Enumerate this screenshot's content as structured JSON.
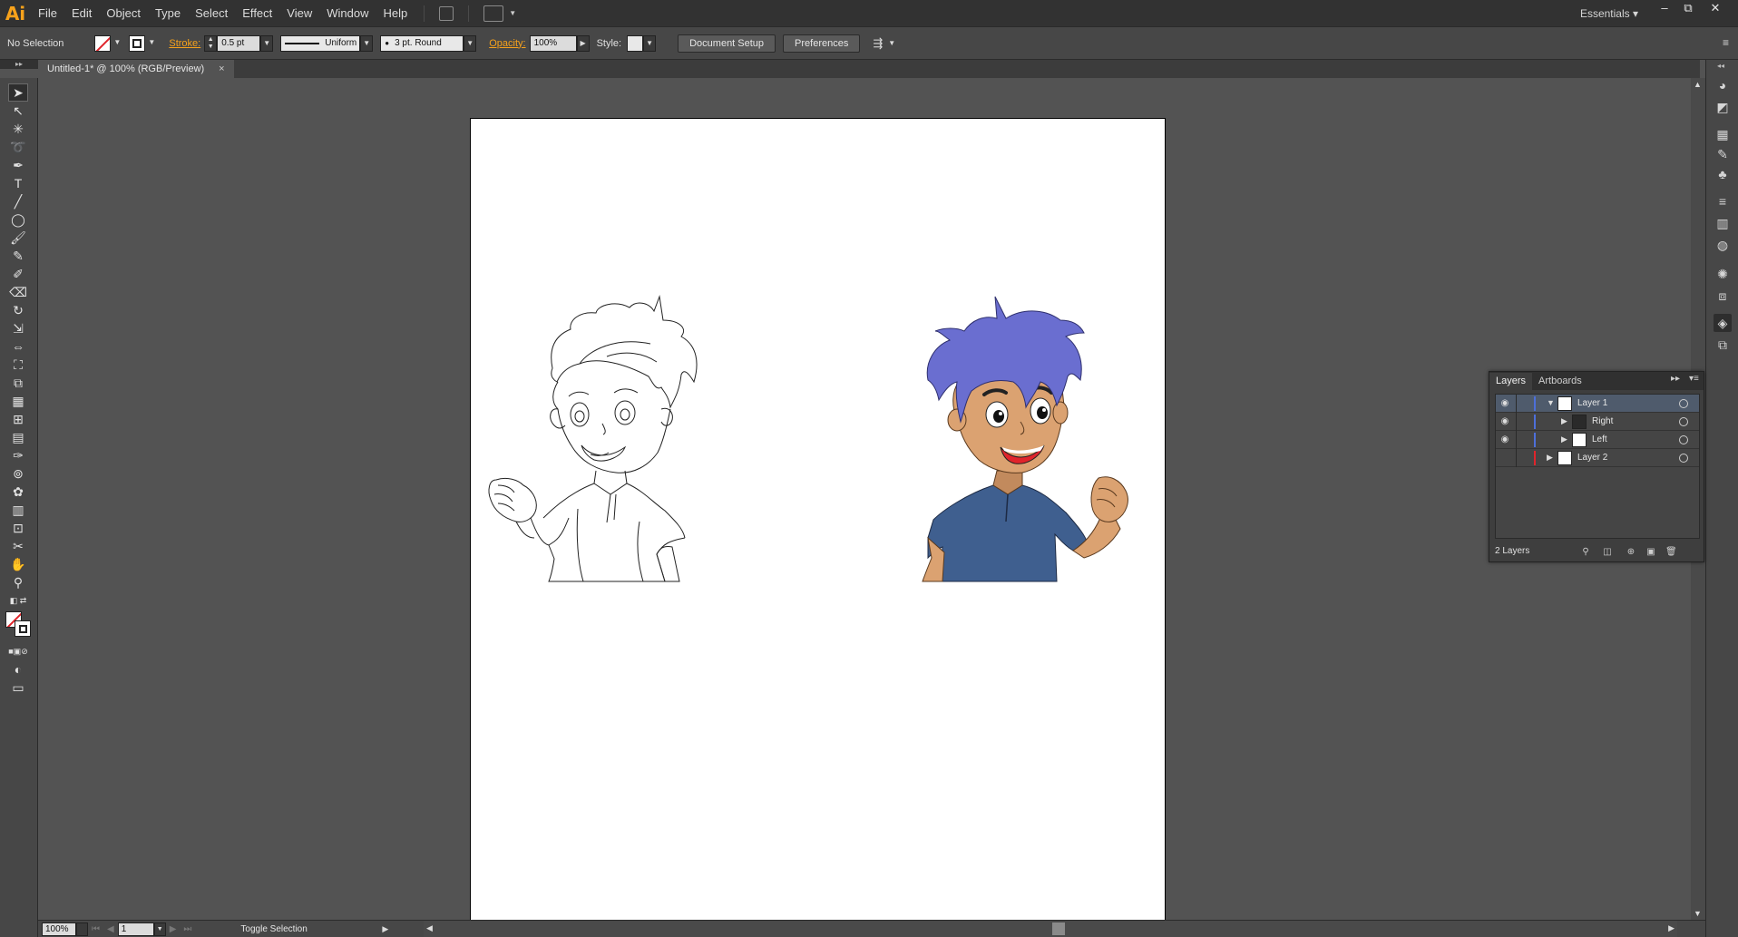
{
  "app": {
    "logo": "Ai",
    "workspace": "Essentials"
  },
  "menu": [
    "File",
    "Edit",
    "Object",
    "Type",
    "Select",
    "Effect",
    "View",
    "Window",
    "Help"
  ],
  "window_controls": {
    "minimize": "–",
    "restore": "⧉",
    "close": "✕"
  },
  "control_bar": {
    "selection_label": "No Selection",
    "stroke_label": "Stroke:",
    "stroke_value": "0.5 pt",
    "profile_value": "Uniform",
    "brush_value": "3 pt. Round",
    "opacity_label": "Opacity:",
    "opacity_value": "100%",
    "style_label": "Style:",
    "document_setup_label": "Document Setup",
    "preferences_label": "Preferences"
  },
  "document_tab": {
    "title": "Untitled-1* @ 100% (RGB/Preview)",
    "close": "×"
  },
  "status_bar": {
    "zoom_value": "100%",
    "artboard_value": "1",
    "status_text": "Toggle Selection"
  },
  "layers_panel": {
    "tabs": [
      "Layers",
      "Artboards"
    ],
    "layers": [
      {
        "name": "Layer 1",
        "visible": true,
        "expanded": true,
        "color": "#4d6fd9",
        "selected": true,
        "indent": 0
      },
      {
        "name": "Right",
        "visible": true,
        "expanded": false,
        "color": "#4d6fd9",
        "selected": false,
        "indent": 1
      },
      {
        "name": "Left",
        "visible": true,
        "expanded": false,
        "color": "#4d6fd9",
        "selected": false,
        "indent": 1
      },
      {
        "name": "Layer 2",
        "visible": false,
        "expanded": false,
        "color": "#e0242b",
        "selected": false,
        "indent": 0
      }
    ],
    "footer_label": "2 Layers"
  },
  "colors": {
    "accent": "#f7a21b",
    "hair_color": "#6a6ed0",
    "shirt_color": "#3f5f8f",
    "skin_color": "#dba271",
    "mouth_color": "#e0242b"
  }
}
